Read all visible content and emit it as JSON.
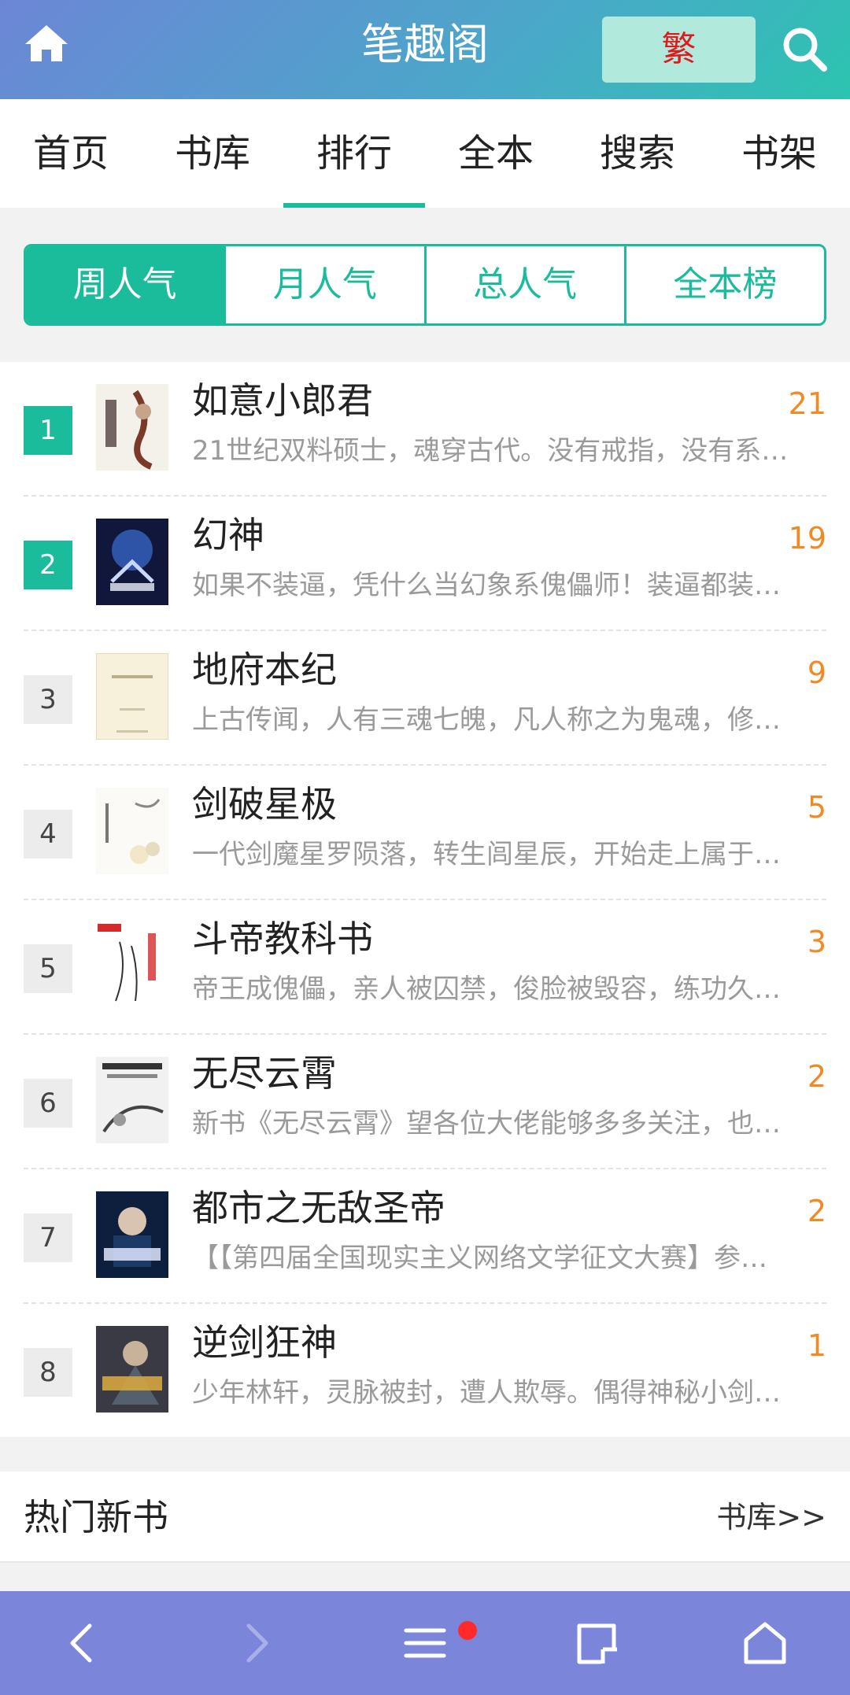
{
  "header": {
    "title": "笔趣阁",
    "trad_label": "繁",
    "home_icon": "home-icon",
    "search_icon": "search-icon"
  },
  "nav": {
    "items": [
      "首页",
      "书库",
      "排行",
      "全本",
      "搜索",
      "书架"
    ],
    "active_index": 2
  },
  "tabs": {
    "items": [
      "周人气",
      "月人气",
      "总人气",
      "全本榜"
    ],
    "active_index": 0
  },
  "books": [
    {
      "rank": "1",
      "title": "如意小郎君",
      "count": "21",
      "desc": "21世纪双料硕士，魂穿古代。没有戒指，没有系…"
    },
    {
      "rank": "2",
      "title": "幻神",
      "count": "19",
      "desc": "如果不装逼，凭什么当幻象系傀儡师！装逼都装…"
    },
    {
      "rank": "3",
      "title": "地府本纪",
      "count": "9",
      "desc": "上古传闻，人有三魂七魄，凡人称之为鬼魂，修…"
    },
    {
      "rank": "4",
      "title": "剑破星极",
      "count": "5",
      "desc": "一代剑魔星罗陨落，转生闾星辰，开始走上属于…"
    },
    {
      "rank": "5",
      "title": "斗帝教科书",
      "count": "3",
      "desc": "帝王成傀儡，亲人被囚禁，俊脸被毁容，练功久…"
    },
    {
      "rank": "6",
      "title": "无尽云霄",
      "count": "2",
      "desc": "新书《无尽云霄》望各位大佬能够多多关注，也…"
    },
    {
      "rank": "7",
      "title": "都市之无敌圣帝",
      "count": "2",
      "desc": "【【第四届全国现实主义网络文学征文大赛】参…"
    },
    {
      "rank": "8",
      "title": "逆剑狂神",
      "count": "1",
      "desc": "少年林轩，灵脉被封，遭人欺辱。偶得神秘小剑…"
    }
  ],
  "section": {
    "title": "热门新书",
    "more": "书库>>"
  },
  "colors": {
    "accent": "#1bbc9b",
    "count": "#f08a24",
    "bottom_bar": "#7b86db",
    "trad_bg": "#b2e9dd",
    "trad_text": "#e0191a"
  },
  "bottom_bar": {
    "icons": [
      "back-icon",
      "forward-icon",
      "menu-icon",
      "tabs-icon",
      "home-icon"
    ]
  }
}
